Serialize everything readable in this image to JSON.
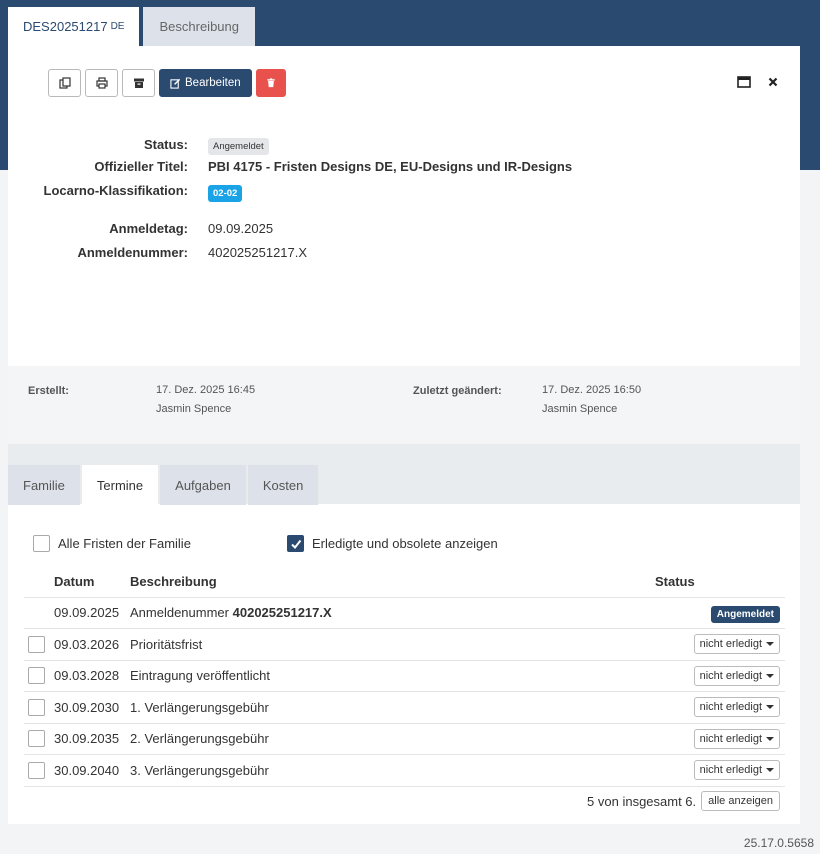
{
  "top_tabs": [
    {
      "label": "DES20251217",
      "suffix": "DE"
    },
    {
      "label": "Beschreibung"
    }
  ],
  "toolbar": {
    "edit_label": "Bearbeiten"
  },
  "fields": {
    "status_label": "Status:",
    "status_value": "Angemeldet",
    "title_label": "Offizieller Titel:",
    "title_value": "PBI 4175 - Fristen Designs DE, EU-Designs und IR-Designs",
    "locarno_label": "Locarno-Klassifikation:",
    "locarno_value": "02-02",
    "anmeldetag_label": "Anmeldetag:",
    "anmeldetag_value": "09.09.2025",
    "anmeldenummer_label": "Anmeldenummer:",
    "anmeldenummer_value": "402025251217.X"
  },
  "meta": {
    "created_label": "Erstellt:",
    "created_date": "17. Dez. 2025 16:45",
    "created_by": "Jasmin Spence",
    "modified_label": "Zuletzt geändert:",
    "modified_date": "17. Dez. 2025 16:50",
    "modified_by": "Jasmin Spence"
  },
  "sub_tabs": [
    "Familie",
    "Termine",
    "Aufgaben",
    "Kosten"
  ],
  "filters": {
    "family_label": "Alle Fristen der Familie",
    "done_label": "Erledigte und obsolete anzeigen"
  },
  "table": {
    "headers": {
      "date": "Datum",
      "description": "Beschreibung",
      "status": "Status"
    },
    "first_row": {
      "date": "09.09.2025",
      "desc_prefix": "Anmeldenummer",
      "desc_bold": "402025251217.X",
      "status": "Angemeldet"
    },
    "rows": [
      {
        "date": "09.03.2026",
        "description": "Prioritätsfrist",
        "status": "nicht erledigt"
      },
      {
        "date": "09.03.2028",
        "description": "Eintragung veröffentlicht",
        "status": "nicht erledigt"
      },
      {
        "date": "30.09.2030",
        "description": "1. Verlängerungsgebühr",
        "status": "nicht erledigt"
      },
      {
        "date": "30.09.2035",
        "description": "2. Verlängerungsgebühr",
        "status": "nicht erledigt"
      },
      {
        "date": "30.09.2040",
        "description": "3. Verlängerungsgebühr",
        "status": "nicht erledigt"
      }
    ]
  },
  "footer": {
    "count_text": "5 von insgesamt 6.",
    "show_all_label": "alle anzeigen"
  },
  "version": "25.17.0.5658",
  "colors": {
    "brand": "#2a4a70",
    "danger": "#e9514c",
    "info": "#1aa3e6"
  }
}
